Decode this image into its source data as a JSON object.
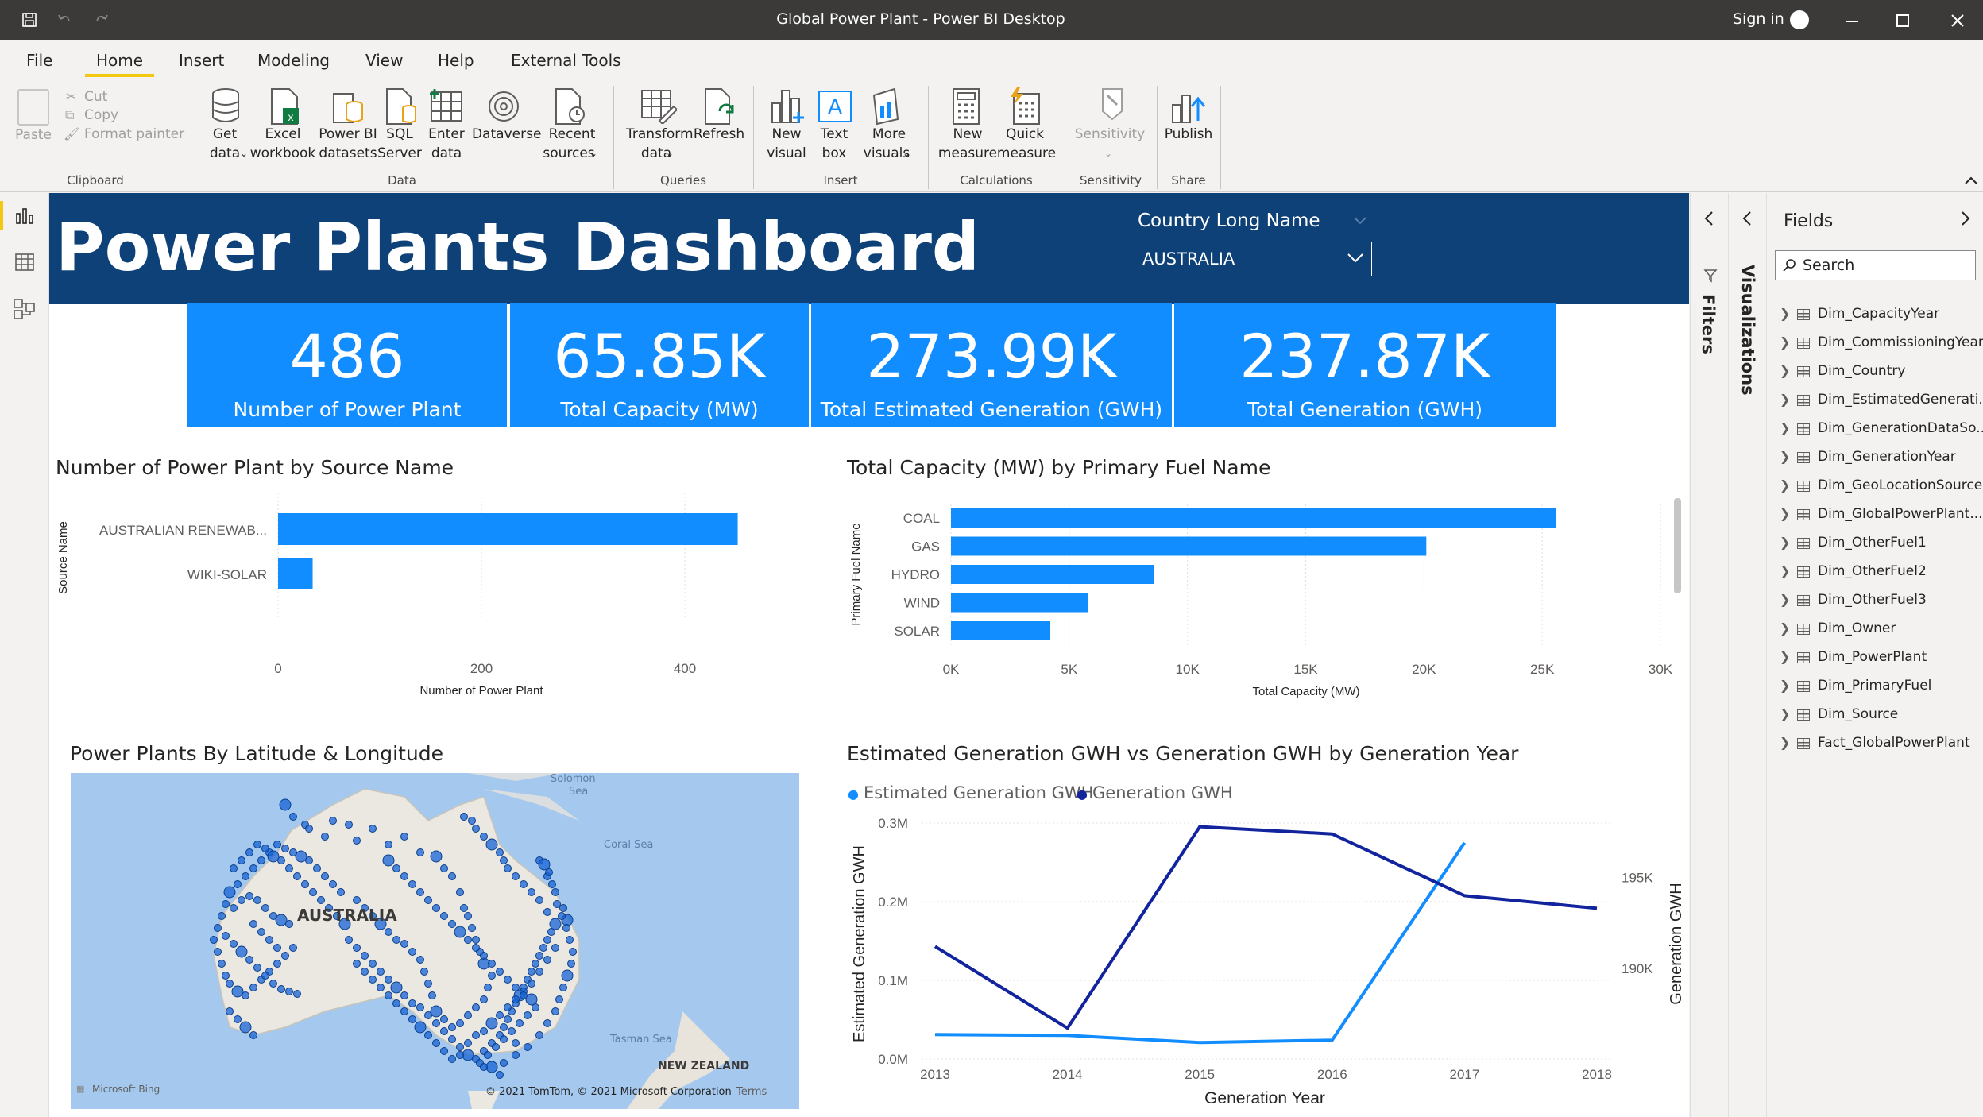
{
  "window": {
    "title": "Global Power Plant - Power BI Desktop",
    "sign_in": "Sign in"
  },
  "menu": [
    "File",
    "Home",
    "Insert",
    "Modeling",
    "View",
    "Help",
    "External Tools"
  ],
  "ribbon": {
    "clipboard": {
      "paste": "Paste",
      "cut": "Cut",
      "copy": "Copy",
      "format_painter": "Format painter",
      "group": "Clipboard"
    },
    "data": {
      "get_data": [
        "Get",
        "data"
      ],
      "excel": [
        "Excel",
        "workbook"
      ],
      "pbi": [
        "Power BI",
        "datasets"
      ],
      "sql": [
        "SQL",
        "Server"
      ],
      "enter": [
        "Enter",
        "data"
      ],
      "dataverse": "Dataverse",
      "recent": [
        "Recent",
        "sources"
      ],
      "group": "Data"
    },
    "queries": {
      "transform": [
        "Transform",
        "data"
      ],
      "refresh": "Refresh",
      "group": "Queries"
    },
    "insert": {
      "new_visual": [
        "New",
        "visual"
      ],
      "text_box": [
        "Text",
        "box"
      ],
      "more": [
        "More",
        "visuals"
      ],
      "group": "Insert"
    },
    "calculations": {
      "new_measure": [
        "New",
        "measure"
      ],
      "quick": [
        "Quick",
        "measure"
      ],
      "group": "Calculations"
    },
    "sensitivity": {
      "label": "Sensitivity",
      "group": "Sensitivity"
    },
    "share": {
      "publish": "Publish",
      "group": "Share"
    }
  },
  "report": {
    "title": "Power Plants Dashboard",
    "slicer": {
      "label": "Country Long Name",
      "value": "AUSTRALIA"
    },
    "kpis": [
      {
        "value": "486",
        "label": "Number of Power Plant"
      },
      {
        "value": "65.85K",
        "label": "Total Capacity (MW)"
      },
      {
        "value": "273.99K",
        "label": "Total Estimated Generation (GWH)"
      },
      {
        "value": "237.87K",
        "label": "Total Generation (GWH)"
      }
    ],
    "map": {
      "title": "Power Plants By Latitude & Longitude",
      "country": "AUSTRALIA",
      "solomon": [
        "Solomon",
        "Sea"
      ],
      "coral": "Coral Sea",
      "tasman": "Tasman Sea",
      "nz": "NEW ZEALAND",
      "bing": "Microsoft Bing",
      "copyright": "© 2021 TomTom, © 2021 Microsoft Corporation",
      "terms": "Terms"
    }
  },
  "chart_data": [
    {
      "type": "bar",
      "title": "Number of Power Plant by Source Name",
      "orientation": "horizontal",
      "categories": [
        "AUSTRALIAN RENEWAB...",
        "WIKI-SOLAR"
      ],
      "values": [
        452,
        34
      ],
      "xlabel": "Number of Power Plant",
      "ylabel": "Source Name",
      "xlim": [
        0,
        500
      ],
      "xticks": [
        "0",
        "200",
        "400"
      ],
      "color": "#118dff"
    },
    {
      "type": "bar",
      "title": "Total Capacity (MW) by Primary Fuel Name",
      "orientation": "horizontal",
      "categories": [
        "COAL",
        "GAS",
        "HYDRO",
        "WIND",
        "SOLAR"
      ],
      "values": [
        25600,
        20100,
        8600,
        5800,
        4200
      ],
      "xlabel": "Total Capacity (MW)",
      "ylabel": "Primary Fuel Name",
      "xlim": [
        0,
        30000
      ],
      "xticks": [
        "0K",
        "5K",
        "10K",
        "15K",
        "20K",
        "25K",
        "30K"
      ],
      "color": "#118dff"
    },
    {
      "type": "line",
      "title": "Estimated Generation GWH vs Generation GWH by Generation Year",
      "x": [
        2013,
        2014,
        2015,
        2016,
        2017,
        2018
      ],
      "series": [
        {
          "name": "Estimated Generation GWH",
          "axis": "left",
          "values": [
            0.031,
            0.03,
            0.021,
            0.024,
            0.275,
            null
          ],
          "color": "#118dff"
        },
        {
          "name": "Generation GWH",
          "axis": "right",
          "values": [
            191200,
            186700,
            197800,
            197400,
            194000,
            193300
          ],
          "color": "#12239e"
        }
      ],
      "xlabel": "Generation Year",
      "ylabel_left": "Estimated Generation GWH",
      "ylabel_right": "Generation GWH",
      "yticks_left": [
        "0.3M",
        "0.2M",
        "0.1M",
        "0.0M"
      ],
      "ylim_left": [
        0,
        0.3
      ],
      "yticks_right": [
        "195K",
        "190K"
      ],
      "ylim_right": [
        185000,
        198000
      ],
      "legend": "top-left"
    }
  ],
  "fields": {
    "title": "Fields",
    "search_placeholder": "Search",
    "tables": [
      "Dim_CapacityYear",
      "Dim_CommissioningYear",
      "Dim_Country",
      "Dim_EstimatedGenerati...",
      "Dim_GenerationDataSo...",
      "Dim_GenerationYear",
      "Dim_GeoLocationSource",
      "Dim_GlobalPowerPlant...",
      "Dim_OtherFuel1",
      "Dim_OtherFuel2",
      "Dim_OtherFuel3",
      "Dim_Owner",
      "Dim_PowerPlant",
      "Dim_PrimaryFuel",
      "Dim_Source",
      "Fact_GlobalPowerPlant"
    ]
  },
  "panes": {
    "filters": "Filters",
    "visualizations": "Visualizations"
  }
}
